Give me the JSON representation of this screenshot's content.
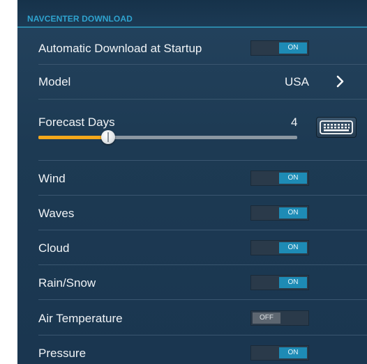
{
  "section": {
    "title": "NAVCENTER DOWNLOAD"
  },
  "rows": {
    "auto_download": {
      "label": "Automatic Download at Startup",
      "toggle": "ON"
    },
    "model": {
      "label": "Model",
      "value": "USA"
    },
    "forecast": {
      "label": "Forecast Days",
      "value": "4",
      "slider_fraction": 0.27
    },
    "wind": {
      "label": "Wind",
      "toggle": "ON"
    },
    "waves": {
      "label": "Waves",
      "toggle": "ON"
    },
    "cloud": {
      "label": "Cloud",
      "toggle": "ON"
    },
    "rain_snow": {
      "label": "Rain/Snow",
      "toggle": "ON"
    },
    "air_temperature": {
      "label": "Air Temperature",
      "toggle": "OFF"
    },
    "pressure": {
      "label": "Pressure",
      "toggle": "ON"
    }
  },
  "icons": {
    "model_chevron": "chevron-right-icon",
    "forecast_keyboard": "keyboard-icon"
  },
  "colors": {
    "accent": "#2fa3cf",
    "toggle_on": "#1e8bb5",
    "toggle_off": "#5d6670",
    "slider_fill": "#f4a81b"
  }
}
